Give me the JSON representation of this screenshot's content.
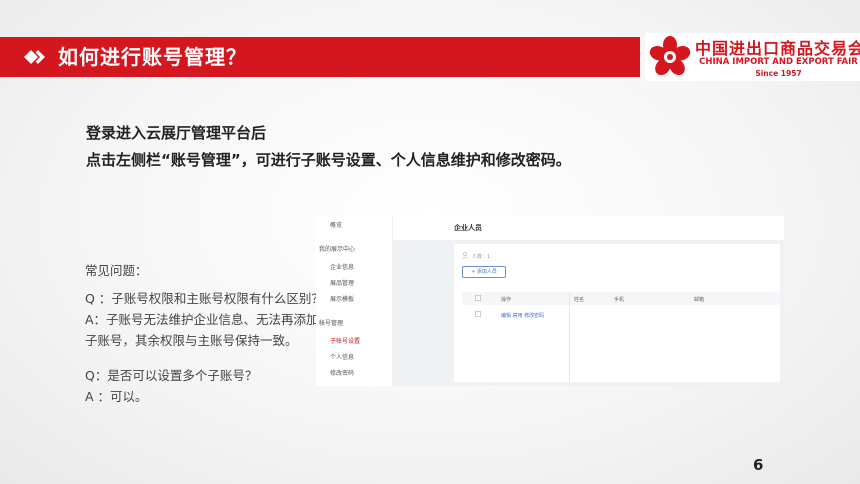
{
  "header": {
    "title": "如何进行账号管理？"
  },
  "logo": {
    "cn": "中国进出口商品交易会",
    "en": "CHINA IMPORT AND EXPORT FAIR",
    "since": "Since 1957"
  },
  "intro": {
    "line1": "登录进入云展厅管理平台后",
    "line2": "点击左侧栏“账号管理”，可进行子账号设置、个人信息维护和修改密码。"
  },
  "faq": {
    "heading": "常见问题：",
    "q1": "Q ：子账号权限和主账号权限有什么区别？",
    "a1_line1": "A：子账号无法维护企业信息、无法再添加",
    "a1_line2": "子账号，其余权限与主账号保持一致。",
    "q2": "Q：是否可以设置多个子账号？",
    "a2": "A ：可以。"
  },
  "screenshot": {
    "sidebar": {
      "overview": "概览",
      "section_exhibit": "我的展示中心",
      "company_info": "企业信息",
      "product_mgmt": "展品管理",
      "template": "展示模板",
      "section_account": "帐号管理",
      "sub_account": "子帐号设置",
      "personal_info": "个人信息",
      "change_password": "修改密码"
    },
    "main": {
      "title": "企业人员",
      "count": "人数：1",
      "add_button": "+ 添加人员",
      "columns": [
        "操作",
        "姓名",
        "手机",
        "邮箱"
      ],
      "row_actions": "编辑  禁用  修改密码"
    }
  },
  "page_number": "6",
  "colors": {
    "brand_red": "#d4171e"
  }
}
